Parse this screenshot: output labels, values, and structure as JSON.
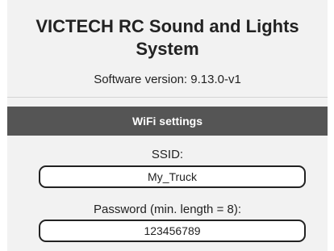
{
  "header": {
    "title": "VICTECH RC Sound and Lights System",
    "software_version": "Software version: 9.13.0-v1"
  },
  "wifi_settings": {
    "section_title": "WiFi settings",
    "ssid": {
      "label": "SSID:",
      "value": "My_Truck"
    },
    "password": {
      "label": "Password (min. length = 8):",
      "value": "123456789"
    }
  },
  "colors": {
    "panel_background": "#f2f2f2",
    "section_header_background": "#555555",
    "section_header_text": "#ffffff",
    "text": "#222222"
  }
}
